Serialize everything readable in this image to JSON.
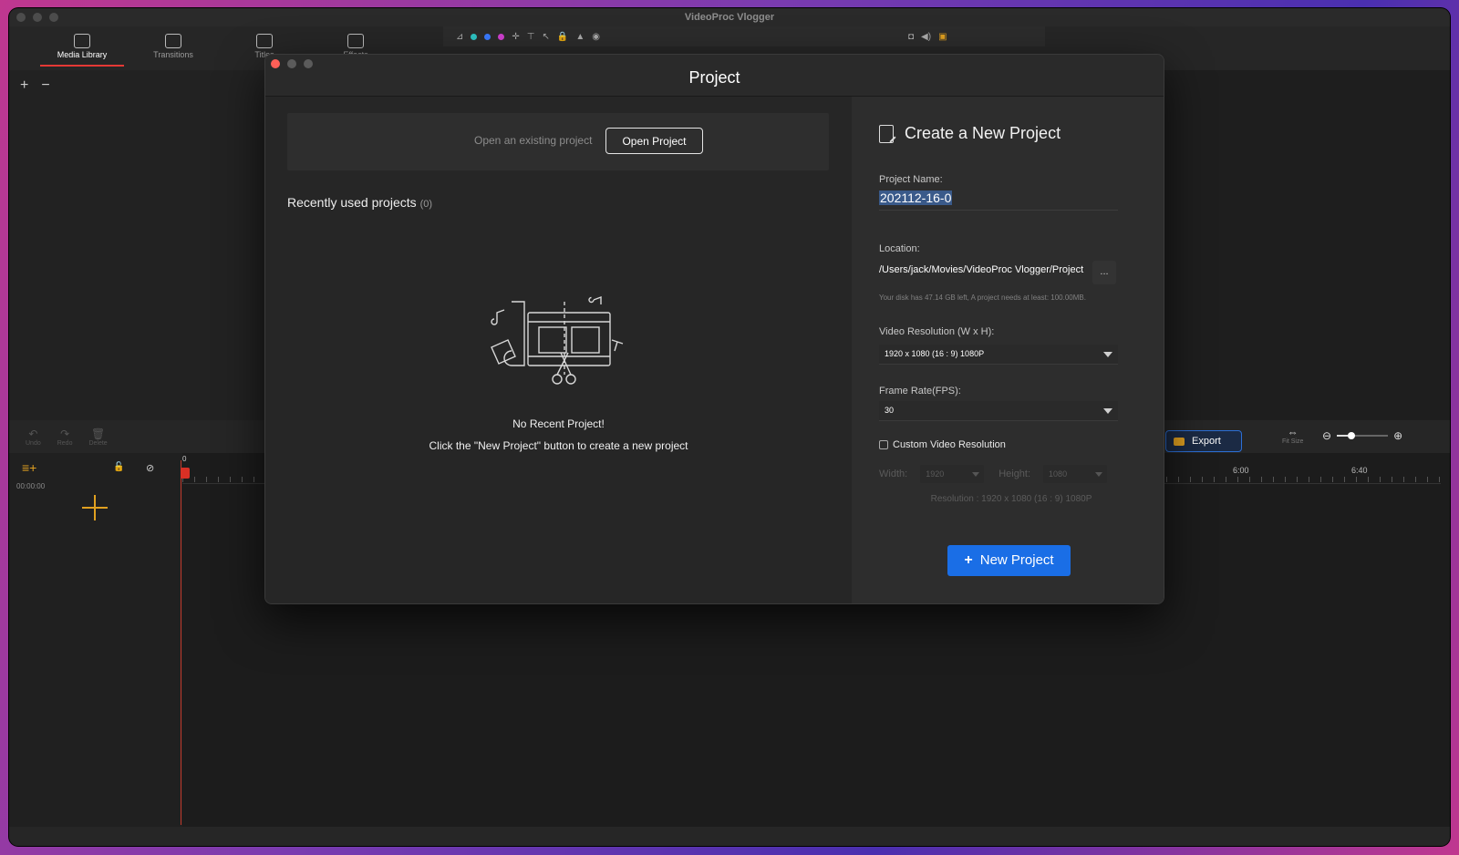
{
  "app": {
    "window_title": "VideoProc Vlogger"
  },
  "library_tabs": [
    {
      "label": "Media Library",
      "active": true
    },
    {
      "label": "Transitions",
      "active": false
    },
    {
      "label": "Titles",
      "active": false
    },
    {
      "label": "Effects",
      "active": false
    }
  ],
  "timeline": {
    "tools": [
      "Undo",
      "Redo",
      "Delete"
    ],
    "timecode": "00:00:00",
    "ruler_start": "0",
    "ruler_marks": [
      "6:00",
      "6:40"
    ],
    "export_label": "Export",
    "fit_size_label": "Fit Size"
  },
  "dialog": {
    "title": "Project",
    "open_existing_text": "Open an existing project",
    "open_button": "Open Project",
    "recent_title": "Recently used projects",
    "recent_count": "(0)",
    "no_recent": "No Recent Project!",
    "no_recent_hint": "Click the \"New Project\" button to create a new project",
    "new_project": {
      "heading": "Create a New Project",
      "name_label": "Project Name:",
      "name_value": "202112-16-0",
      "location_label": "Location:",
      "location_value": "/Users/jack/Movies/VideoProc Vlogger/Project",
      "location_button": "...",
      "disk_note": "Your disk has 47.14 GB left, A project needs at least: 100.00MB.",
      "resolution_label": "Video Resolution (W x H):",
      "resolution_value": "1920 x 1080 (16 : 9) 1080P",
      "fps_label": "Frame Rate(FPS):",
      "fps_value": "30",
      "custom_res_label": "Custom Video Resolution",
      "custom_res_checked": false,
      "width_label": "Width:",
      "width_value": "1920",
      "height_label": "Height:",
      "height_value": "1080",
      "resolution_note": "Resolution : 1920 x 1080 (16 : 9) 1080P",
      "create_button": "New Project"
    }
  },
  "colors": {
    "accent_blue": "#1a6ee6",
    "close_red": "#ff5f57",
    "playhead_red": "#d93025",
    "add_orange": "#e0a020"
  }
}
